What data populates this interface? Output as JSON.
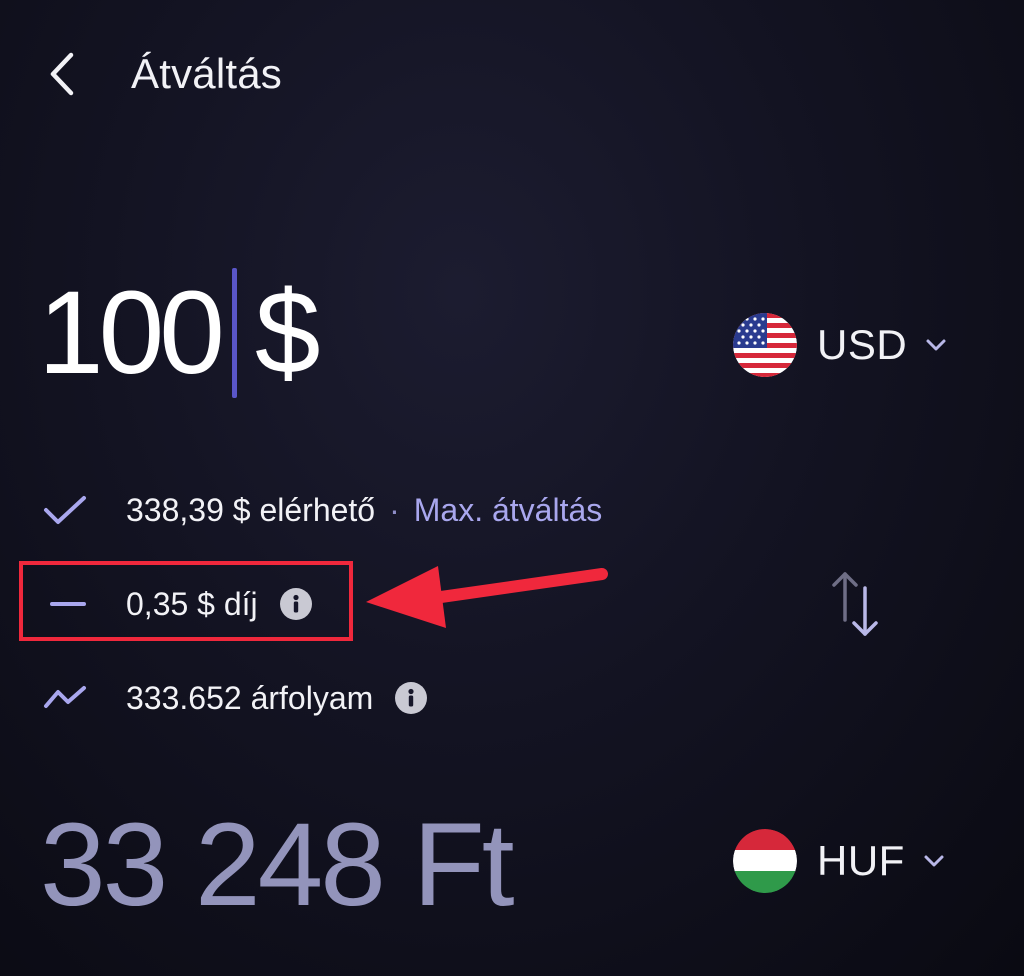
{
  "header": {
    "title": "Átváltás",
    "back_icon": "chevron-left-icon"
  },
  "from": {
    "amount": "100",
    "symbol": "$",
    "currency_code": "USD",
    "flag_icon": "us-flag-icon"
  },
  "info": {
    "available_text": "338,39 $ elérhető",
    "separator": "·",
    "max_link": "Max. átváltás",
    "fee_text": "0,35 $ díj",
    "rate_text": "333.652 árfolyam",
    "check_icon": "check-icon",
    "minus_icon": "minus-icon",
    "trend_icon": "trend-icon",
    "info_icon": "info-icon",
    "swap_icon": "swap-arrows-icon"
  },
  "to": {
    "amount": "33 248 Ft",
    "currency_code": "HUF",
    "flag_icon": "hu-flag-icon"
  },
  "colors": {
    "background": "#131322",
    "accent": "#a9a7ee",
    "caret": "#5a56c8",
    "muted_amount": "#9394bb",
    "annotation_red": "#f0283c"
  }
}
